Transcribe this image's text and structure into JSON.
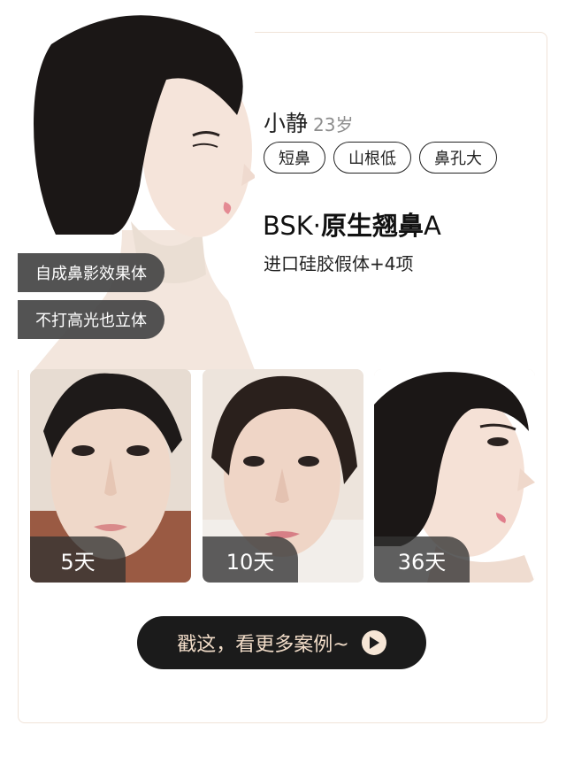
{
  "profile": {
    "name": "小静",
    "age": "23岁"
  },
  "tags": [
    "短鼻",
    "山根低",
    "鼻孔大"
  ],
  "product": {
    "prefix": "BSK·",
    "name": "原生翘鼻",
    "suffix": "A"
  },
  "subtitle": "进口硅胶假体+4项",
  "features": [
    "自成鼻影效果体",
    "不打高光也立体"
  ],
  "progress_photos": [
    {
      "day": "5天"
    },
    {
      "day": "10天"
    },
    {
      "day": "36天"
    }
  ],
  "cta": {
    "label": "戳这，看更多案例~",
    "icon": "play-icon"
  },
  "colors": {
    "accent_dark": "#1b1b1b",
    "accent_light": "#f1dcc8",
    "badge_bg": "#444444"
  }
}
